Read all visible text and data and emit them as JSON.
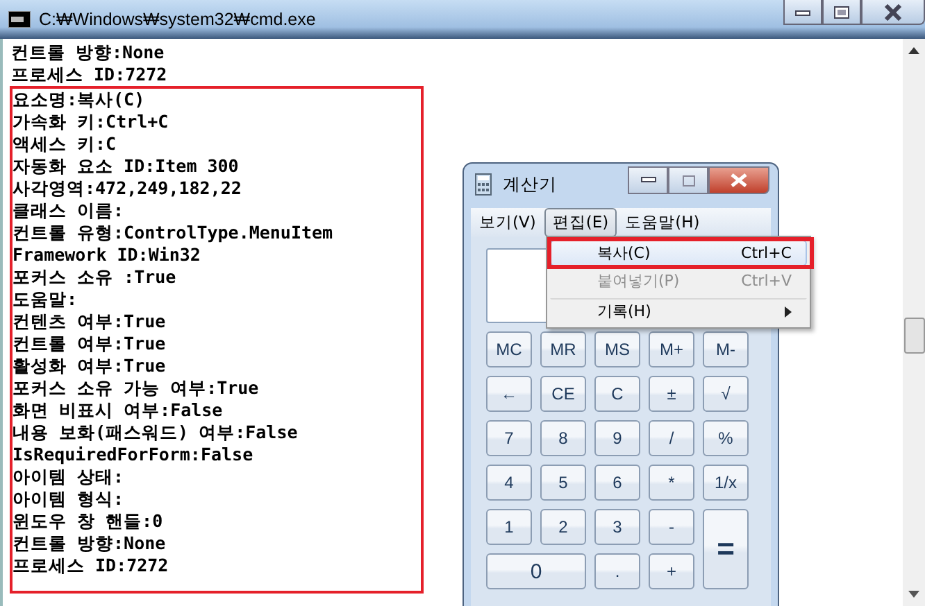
{
  "console_window": {
    "title": "C:₩Windows₩system32₩cmd.exe",
    "lines": [
      "컨트롤 방향:None",
      "프로세스 ID:7272"
    ],
    "highlighted_lines": [
      "요소명:복사(C)",
      "가속화 키:Ctrl+C",
      "액세스 키:C",
      "자동화 요소 ID:Item 300",
      "사각영역:472,249,182,22",
      "클래스 이름:",
      "컨트롤 유형:ControlType.MenuItem",
      "Framework ID:Win32",
      "포커스 소유 :True",
      "도움말:",
      "컨텐츠 여부:True",
      "컨트롤 여부:True",
      "활성화 여부:True",
      "포커스 소유 가능 여부:True",
      "화면 비표시 여부:False",
      "내용 보화(패스워드) 여부:False",
      "IsRequiredForForm:False",
      "아이템 상태:",
      "아이템 형식:",
      "윈도우 창 핸들:0",
      "컨트롤 방향:None",
      "프로세스 ID:7272"
    ]
  },
  "calculator": {
    "title": "계산기",
    "menu_bar": [
      {
        "label": "보기(V)",
        "selected": false
      },
      {
        "label": "편집(E)",
        "selected": true
      },
      {
        "label": "도움말(H)",
        "selected": false
      }
    ],
    "menu": [
      {
        "label": "복사(C)",
        "shortcut": "Ctrl+C",
        "selected": true,
        "disabled": false,
        "submenu": false
      },
      {
        "label": "붙여넣기(P)",
        "shortcut": "Ctrl+V",
        "selected": false,
        "disabled": true,
        "submenu": false
      },
      {
        "label": "기록(H)",
        "selected": false,
        "disabled": false,
        "submenu": true
      }
    ],
    "buttons": [
      {
        "label": "MC"
      },
      {
        "label": "MR"
      },
      {
        "label": "MS"
      },
      {
        "label": "M+"
      },
      {
        "label": "M-"
      },
      {
        "label": "←"
      },
      {
        "label": "CE"
      },
      {
        "label": "C"
      },
      {
        "label": "±"
      },
      {
        "label": "√"
      },
      {
        "label": "7"
      },
      {
        "label": "8"
      },
      {
        "label": "9"
      },
      {
        "label": "/"
      },
      {
        "label": "%"
      },
      {
        "label": "4"
      },
      {
        "label": "5"
      },
      {
        "label": "6"
      },
      {
        "label": "*"
      },
      {
        "label": "1/x"
      },
      {
        "label": "1"
      },
      {
        "label": "2"
      },
      {
        "label": "3"
      },
      {
        "label": "-"
      },
      {
        "label": "=",
        "kind": "tall"
      },
      {
        "label": "0",
        "kind": "wide"
      },
      {
        "label": "."
      },
      {
        "label": "+"
      }
    ]
  }
}
